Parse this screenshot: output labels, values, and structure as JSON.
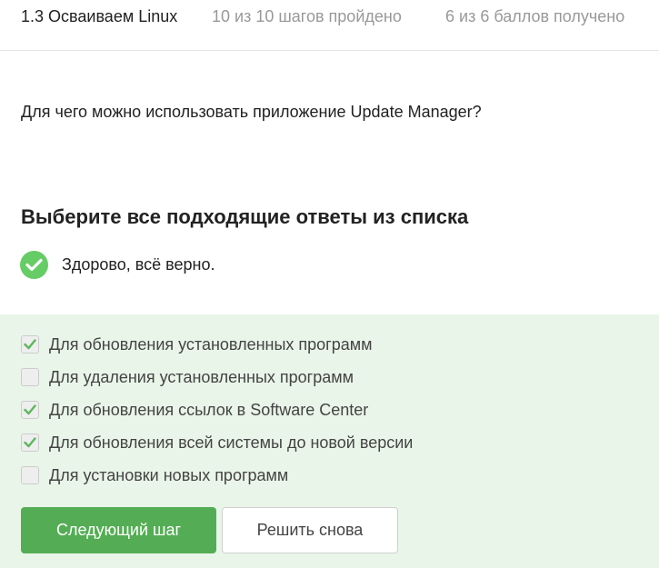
{
  "header": {
    "lesson_title": "1.3 Осваиваем Linux",
    "steps_progress": "10 из 10 шагов пройдено",
    "score_progress": "6 из 6 баллов  получено"
  },
  "question": {
    "text": "Для чего можно использовать приложение Update Manager?"
  },
  "quiz": {
    "instruction": "Выберите все подходящие ответы из списка",
    "feedback": "Здорово, всё верно.",
    "feedback_icon": "check-circle-icon",
    "success_color": "#66cc66",
    "options": [
      {
        "label": "Для обновления установленных программ",
        "checked": true
      },
      {
        "label": "Для удаления установленных программ",
        "checked": false
      },
      {
        "label": "Для обновления ссылок в Software Center",
        "checked": true
      },
      {
        "label": "Для обновления всей системы до новой версии",
        "checked": true
      },
      {
        "label": "Для установки новых программ",
        "checked": false
      }
    ]
  },
  "actions": {
    "next_label": "Следующий шаг",
    "retry_label": "Решить снова",
    "next_color": "#54ad54"
  }
}
